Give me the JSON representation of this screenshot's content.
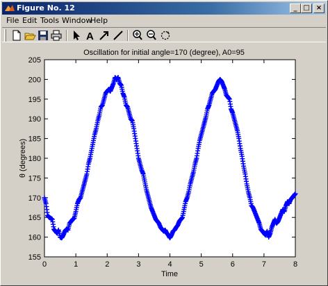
{
  "window": {
    "title": "Figure No. 12",
    "buttons": {
      "minimize": "_",
      "maximize": "□",
      "close": "×"
    }
  },
  "menu": [
    {
      "name": "file",
      "label": "File"
    },
    {
      "name": "edit",
      "label": "Edit"
    },
    {
      "name": "tools",
      "label": "Tools"
    },
    {
      "name": "window",
      "label": "Window"
    },
    {
      "name": "help",
      "label": "Help"
    }
  ],
  "toolbar": {
    "icons": [
      "new-document-icon",
      "open-folder-icon",
      "save-icon",
      "print-icon",
      "pointer-arrow-icon",
      "text-insert-icon",
      "arrow-insert-icon",
      "line-insert-icon",
      "zoom-in-icon",
      "zoom-out-icon",
      "rotate-3d-icon"
    ]
  },
  "colors": {
    "series": "#0000ff",
    "titlebar": "#0a246a"
  },
  "chart_data": {
    "type": "line",
    "marker": "+",
    "title": "Oscillation for initial angle=170 (degree), A0=95",
    "xlabel": "Time",
    "ylabel": "θ (degrees)",
    "xlim": [
      0,
      8
    ],
    "ylim": [
      155,
      205
    ],
    "xticks": [
      0,
      1,
      2,
      3,
      4,
      5,
      6,
      7,
      8
    ],
    "yticks": [
      155,
      160,
      165,
      170,
      175,
      180,
      185,
      190,
      195,
      200,
      205
    ],
    "grid": false,
    "series": [
      {
        "color": "#0000ff",
        "points": [
          [
            0.0,
            170.0
          ],
          [
            0.05,
            168.5
          ],
          [
            0.1,
            165.5
          ],
          [
            0.15,
            165.0
          ],
          [
            0.2,
            164.8
          ],
          [
            0.25,
            164.5
          ],
          [
            0.3,
            162.0
          ],
          [
            0.35,
            161.5
          ],
          [
            0.4,
            161.0
          ],
          [
            0.45,
            161.8
          ],
          [
            0.5,
            160.0
          ],
          [
            0.55,
            159.8
          ],
          [
            0.6,
            160.5
          ],
          [
            0.65,
            161.5
          ],
          [
            0.7,
            162.0
          ],
          [
            0.75,
            161.8
          ],
          [
            0.8,
            163.5
          ],
          [
            0.85,
            164.0
          ],
          [
            0.9,
            164.5
          ],
          [
            0.95,
            164.8
          ],
          [
            1.0,
            166.5
          ],
          [
            1.05,
            168.5
          ],
          [
            1.1,
            169.5
          ],
          [
            1.15,
            170.0
          ],
          [
            1.2,
            171.5
          ],
          [
            1.25,
            173.0
          ],
          [
            1.3,
            174.5
          ],
          [
            1.35,
            176.0
          ],
          [
            1.4,
            178.5
          ],
          [
            1.45,
            180.0
          ],
          [
            1.5,
            182.0
          ],
          [
            1.55,
            184.0
          ],
          [
            1.6,
            186.0
          ],
          [
            1.65,
            187.5
          ],
          [
            1.7,
            189.5
          ],
          [
            1.75,
            191.0
          ],
          [
            1.8,
            193.0
          ],
          [
            1.85,
            193.5
          ],
          [
            1.9,
            195.0
          ],
          [
            1.95,
            196.5
          ],
          [
            2.0,
            197.0
          ],
          [
            2.05,
            197.5
          ],
          [
            2.1,
            197.0
          ],
          [
            2.15,
            198.0
          ],
          [
            2.2,
            199.0
          ],
          [
            2.25,
            200.5
          ],
          [
            2.3,
            200.0
          ],
          [
            2.35,
            200.5
          ],
          [
            2.4,
            199.0
          ],
          [
            2.45,
            198.5
          ],
          [
            2.5,
            196.5
          ],
          [
            2.55,
            195.5
          ],
          [
            2.6,
            193.5
          ],
          [
            2.65,
            193.0
          ],
          [
            2.7,
            191.5
          ],
          [
            2.75,
            190.0
          ],
          [
            2.8,
            189.5
          ],
          [
            2.85,
            187.5
          ],
          [
            2.9,
            185.0
          ],
          [
            2.95,
            182.5
          ],
          [
            3.0,
            180.0
          ],
          [
            3.05,
            178.5
          ],
          [
            3.1,
            177.0
          ],
          [
            3.15,
            176.0
          ],
          [
            3.2,
            174.0
          ],
          [
            3.25,
            172.0
          ],
          [
            3.3,
            170.5
          ],
          [
            3.35,
            169.0
          ],
          [
            3.4,
            167.5
          ],
          [
            3.45,
            166.5
          ],
          [
            3.5,
            165.5
          ],
          [
            3.55,
            164.5
          ],
          [
            3.6,
            164.0
          ],
          [
            3.65,
            163.5
          ],
          [
            3.7,
            162.5
          ],
          [
            3.75,
            162.0
          ],
          [
            3.8,
            161.5
          ],
          [
            3.85,
            161.8
          ],
          [
            3.9,
            161.0
          ],
          [
            3.95,
            160.5
          ],
          [
            4.0,
            159.8
          ],
          [
            4.05,
            160.5
          ],
          [
            4.1,
            161.5
          ],
          [
            4.15,
            161.8
          ],
          [
            4.2,
            162.5
          ],
          [
            4.25,
            163.0
          ],
          [
            4.3,
            164.0
          ],
          [
            4.35,
            164.5
          ],
          [
            4.4,
            165.0
          ],
          [
            4.45,
            167.0
          ],
          [
            4.5,
            169.0
          ],
          [
            4.55,
            170.0
          ],
          [
            4.6,
            171.5
          ],
          [
            4.65,
            173.5
          ],
          [
            4.7,
            175.0
          ],
          [
            4.75,
            176.5
          ],
          [
            4.8,
            178.5
          ],
          [
            4.85,
            180.0
          ],
          [
            4.9,
            182.5
          ],
          [
            4.95,
            184.5
          ],
          [
            5.0,
            186.0
          ],
          [
            5.05,
            187.5
          ],
          [
            5.1,
            189.0
          ],
          [
            5.15,
            190.5
          ],
          [
            5.2,
            192.5
          ],
          [
            5.25,
            193.5
          ],
          [
            5.3,
            195.0
          ],
          [
            5.35,
            196.5
          ],
          [
            5.4,
            197.0
          ],
          [
            5.45,
            197.5
          ],
          [
            5.5,
            198.5
          ],
          [
            5.55,
            199.5
          ],
          [
            5.6,
            200.0
          ],
          [
            5.65,
            199.5
          ],
          [
            5.7,
            198.5
          ],
          [
            5.75,
            197.5
          ],
          [
            5.8,
            196.0
          ],
          [
            5.85,
            195.5
          ],
          [
            5.9,
            195.0
          ],
          [
            5.95,
            192.5
          ],
          [
            6.0,
            191.5
          ],
          [
            6.05,
            190.0
          ],
          [
            6.1,
            188.5
          ],
          [
            6.15,
            187.0
          ],
          [
            6.2,
            185.0
          ],
          [
            6.25,
            182.5
          ],
          [
            6.3,
            180.5
          ],
          [
            6.35,
            178.0
          ],
          [
            6.4,
            176.0
          ],
          [
            6.45,
            173.5
          ],
          [
            6.5,
            171.5
          ],
          [
            6.55,
            170.0
          ],
          [
            6.6,
            168.0
          ],
          [
            6.65,
            167.5
          ],
          [
            6.7,
            166.5
          ],
          [
            6.75,
            165.5
          ],
          [
            6.8,
            164.5
          ],
          [
            6.85,
            163.5
          ],
          [
            6.9,
            162.0
          ],
          [
            6.95,
            161.5
          ],
          [
            7.0,
            161.0
          ],
          [
            7.05,
            160.5
          ],
          [
            7.1,
            161.5
          ],
          [
            7.15,
            160.0
          ],
          [
            7.2,
            161.0
          ],
          [
            7.25,
            162.5
          ],
          [
            7.3,
            163.5
          ],
          [
            7.35,
            164.5
          ],
          [
            7.4,
            163.5
          ],
          [
            7.45,
            164.0
          ],
          [
            7.5,
            165.0
          ],
          [
            7.55,
            166.0
          ],
          [
            7.6,
            167.0
          ],
          [
            7.65,
            166.5
          ],
          [
            7.7,
            168.0
          ],
          [
            7.75,
            169.0
          ],
          [
            7.8,
            168.5
          ],
          [
            7.85,
            169.5
          ],
          [
            7.9,
            170.0
          ],
          [
            7.95,
            170.5
          ],
          [
            8.0,
            171.0
          ]
        ]
      }
    ]
  }
}
